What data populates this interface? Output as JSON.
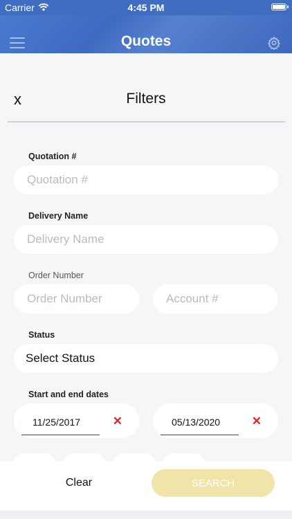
{
  "status_bar": {
    "carrier": "Carrier",
    "time": "4:45 PM"
  },
  "nav": {
    "title": "Quotes",
    "menu_icon": "hamburger-menu-icon",
    "settings_icon": "gear-icon"
  },
  "filters": {
    "close_label": "x",
    "title": "Filters"
  },
  "fields": {
    "quotation": {
      "label": "Quotation #",
      "placeholder": "Quotation #",
      "value": ""
    },
    "delivery_name": {
      "label": "Delivery Name",
      "placeholder": "Delivery Name",
      "value": ""
    },
    "order_number": {
      "label": "Order Number",
      "placeholder": "Order Number",
      "value": ""
    },
    "account": {
      "placeholder": "Account #",
      "value": ""
    },
    "status": {
      "label": "Status",
      "selected": "Select Status"
    },
    "dates": {
      "label": "Start and end dates",
      "start": "11/25/2017",
      "end": "05/13/2020",
      "clear_glyph": "✕"
    }
  },
  "actions": {
    "clear_label": "Clear",
    "search_label": "SEARCH"
  },
  "colors": {
    "nav_blue": "#3f6dc0",
    "search_disabled": "#f1e4a8",
    "clear_red": "#e0262b"
  }
}
